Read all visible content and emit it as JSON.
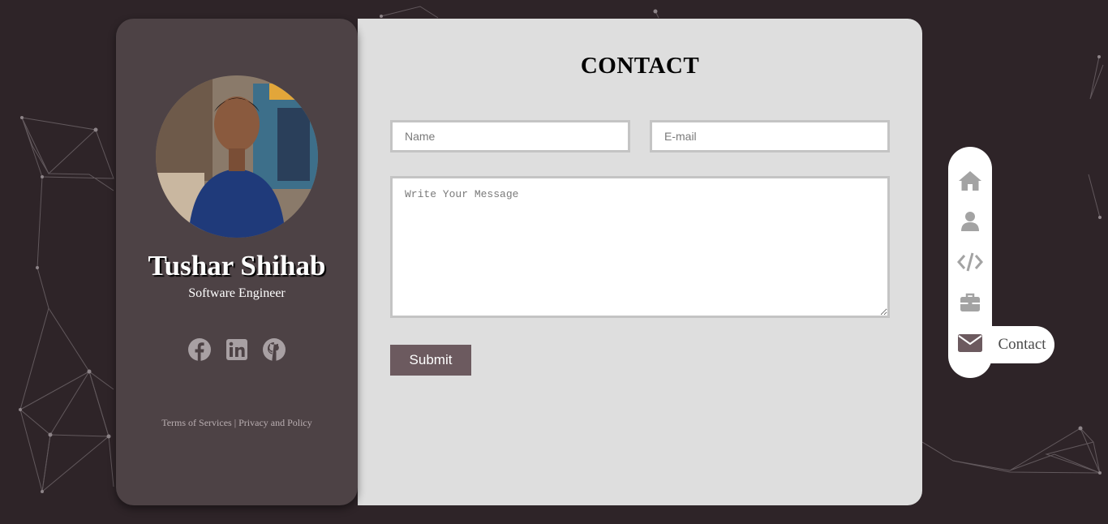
{
  "profile": {
    "name": "Tushar Shihab",
    "title": "Software Engineer",
    "social": [
      {
        "icon": "facebook-icon"
      },
      {
        "icon": "linkedin-icon"
      },
      {
        "icon": "github-icon"
      }
    ],
    "footer": {
      "terms": "Terms of Services",
      "separator": "|",
      "privacy": "Privacy and Policy"
    }
  },
  "contact": {
    "heading": "CONTACT",
    "name_placeholder": "Name",
    "email_placeholder": "E-mail",
    "message_placeholder": "Write Your Message",
    "submit_label": "Submit"
  },
  "nav": {
    "items": [
      {
        "icon": "home-icon"
      },
      {
        "icon": "user-icon"
      },
      {
        "icon": "code-icon"
      },
      {
        "icon": "briefcase-icon"
      },
      {
        "icon": "envelope-icon",
        "active": true
      }
    ],
    "active_label": "Contact"
  },
  "colors": {
    "page_bg": "#2e2428",
    "card_bg": "#4d4245",
    "panel_bg": "#dedede",
    "accent": "#6c5a5f",
    "nav_icon": "#a3a3a3",
    "nav_active_icon": "#6c5a5f"
  }
}
